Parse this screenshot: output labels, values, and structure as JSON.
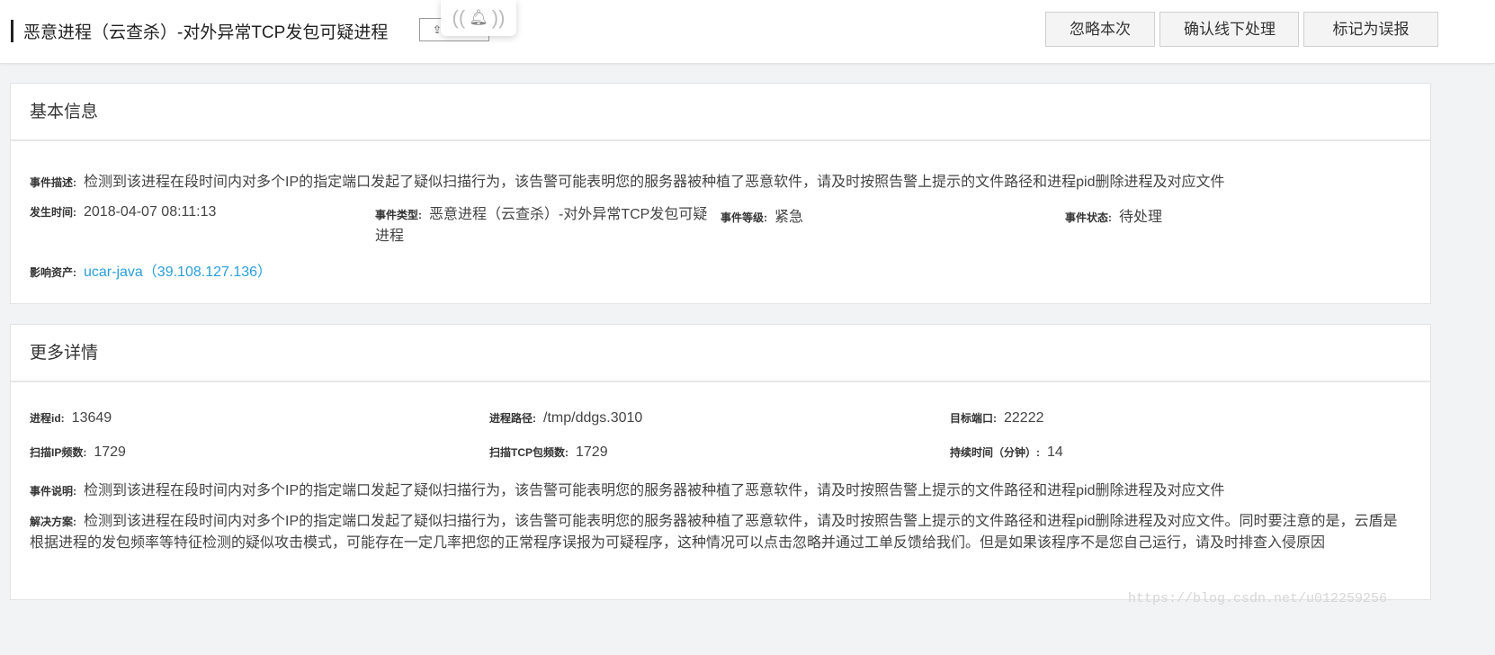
{
  "header": {
    "title": "恶意进程（云查杀）-对外异常TCP发包可疑进程",
    "buttons": {
      "ignore": "忽略本次",
      "confirm": "确认线下处理",
      "false_positive": "标记为误报"
    }
  },
  "basic": {
    "heading": "基本信息",
    "desc_label": "事件描述:",
    "desc": "检测到该进程在段时间内对多个IP的指定端口发起了疑似扫描行为，该告警可能表明您的服务器被种植了恶意软件，请及时按照告警上提示的文件路径和进程pid删除进程及对应文件",
    "time_label": "发生时间:",
    "time": "2018-04-07 08:11:13",
    "type_label": "事件类型:",
    "type": "恶意进程（云查杀）-对外异常TCP发包可疑进程",
    "level_label": "事件等级:",
    "level": "紧急",
    "status_label": "事件状态:",
    "status": "待处理",
    "asset_label": "影响资产:",
    "asset": "ucar-java（39.108.127.136）"
  },
  "details": {
    "heading": "更多详情",
    "pid_label": "进程id:",
    "pid": "13649",
    "path_label": "进程路径:",
    "path": "/tmp/ddgs.3010",
    "port_label": "目标端口:",
    "port": "22222",
    "scan_ip_label": "扫描IP频数:",
    "scan_ip": "1729",
    "scan_tcp_label": "扫描TCP包频数:",
    "scan_tcp": "1729",
    "duration_label": "持续时间（分钟）:",
    "duration": "14",
    "explain_label": "事件说明:",
    "explain": "检测到该进程在段时间内对多个IP的指定端口发起了疑似扫描行为，该告警可能表明您的服务器被种植了恶意软件，请及时按照告警上提示的文件路径和进程pid删除进程及对应文件",
    "solution_label": "解决方案:",
    "solution": "检测到该进程在段时间内对多个IP的指定端口发起了疑似扫描行为，该告警可能表明您的服务器被种植了恶意软件，请及时按照告警上提示的文件路径和进程pid删除进程及对应文件。同时要注意的是，云盾是根据进程的发包频率等特征检测的疑似攻击模式，可能存在一定几率把您的正常程序误报为可疑程序，这种情况可以点击忽略并通过工单反馈给我们。但是如果该程序不是您自己运行，请及时排查入侵原因"
  },
  "watermark": "https://blog.csdn.net/u012259256",
  "icons": {
    "bell": "bell-icon"
  }
}
